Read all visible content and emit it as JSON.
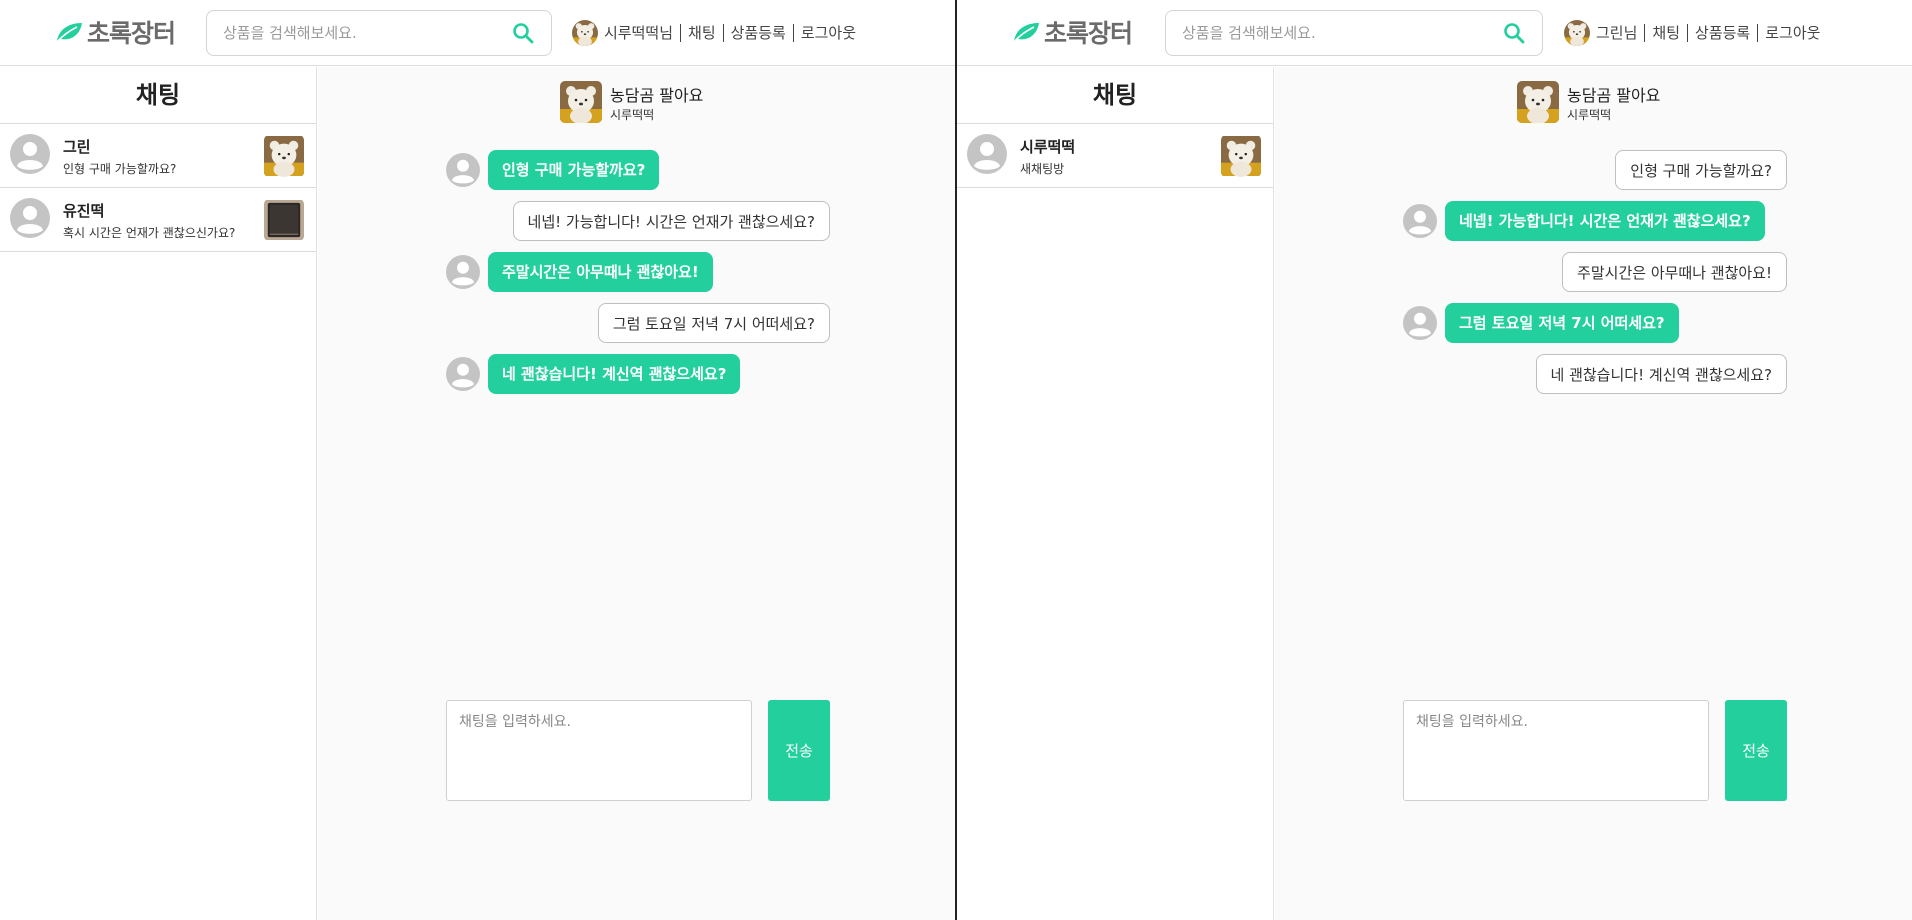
{
  "colors": {
    "accent": "#23d09d",
    "text": "#222222",
    "border": "#d0d0d0"
  },
  "left": {
    "header": {
      "logo_text": "초록장터",
      "search_placeholder": "상품을 검색해보세요.",
      "user_label": "시루떡떡님",
      "nav_chat": "채팅",
      "nav_register": "상품등록",
      "nav_logout": "로그아웃"
    },
    "sidebar": {
      "title": "채팅",
      "rooms": [
        {
          "name": "그린",
          "last_message": "인형 구매 가능할까요?",
          "thumb": "bear"
        },
        {
          "name": "유진떡",
          "last_message": "혹시 시간은 언재가 괜찮으신가요?",
          "thumb": "dark-item"
        }
      ]
    },
    "chat": {
      "product_title": "농담곰 팔아요",
      "seller": "시루떡떡",
      "messages": [
        {
          "side": "other",
          "text": "인형 구매 가능할까요?"
        },
        {
          "side": "mine",
          "text": "네넵! 가능합니다! 시간은 언재가 괜찮으세요?"
        },
        {
          "side": "other",
          "text": "주말시간은 아무때나 괜찮아요!"
        },
        {
          "side": "mine",
          "text": "그럼 토요일 저녁 7시 어떠세요?"
        },
        {
          "side": "other",
          "text": "네 괜찮습니다! 계신역 괜찮으세요?"
        }
      ],
      "input_placeholder": "채팅을 입력하세요.",
      "send_label": "전송"
    }
  },
  "right": {
    "header": {
      "logo_text": "초록장터",
      "search_placeholder": "상품을 검색해보세요.",
      "user_label": "그린님",
      "nav_chat": "채팅",
      "nav_register": "상품등록",
      "nav_logout": "로그아웃"
    },
    "sidebar": {
      "title": "채팅",
      "rooms": [
        {
          "name": "시루떡떡",
          "last_message": "새채팅방",
          "thumb": "bear"
        }
      ]
    },
    "chat": {
      "product_title": "농담곰 팔아요",
      "seller": "시루떡떡",
      "messages": [
        {
          "side": "mine",
          "text": "인형 구매 가능할까요?"
        },
        {
          "side": "other",
          "text": "네넵! 가능합니다! 시간은 언재가 괜찮으세요?"
        },
        {
          "side": "mine",
          "text": "주말시간은 아무때나 괜찮아요!"
        },
        {
          "side": "other",
          "text": "그럼 토요일 저녁 7시 어떠세요?"
        },
        {
          "side": "mine",
          "text": "네 괜찮습니다! 계신역 괜찮으세요?"
        }
      ],
      "input_placeholder": "채팅을 입력하세요.",
      "send_label": "전송"
    }
  }
}
